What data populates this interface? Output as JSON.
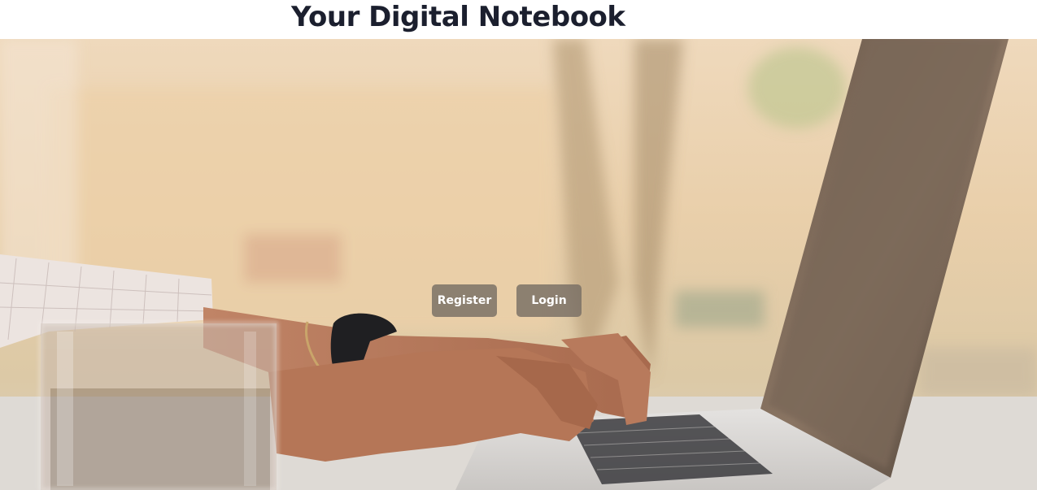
{
  "header": {
    "title": "Your Digital Notebook"
  },
  "hero": {
    "register_label": "Register",
    "login_label": "Login"
  }
}
